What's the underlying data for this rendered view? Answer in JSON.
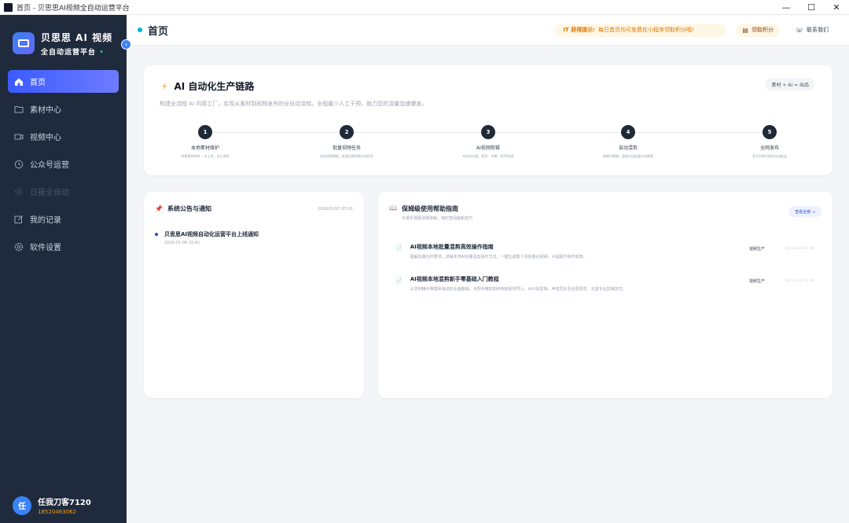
{
  "window": {
    "title": "首页 - 贝思思AI视频全自动运营平台",
    "minimize": "—",
    "maximize": "☐",
    "close": "✕"
  },
  "sidebar": {
    "brand_title": "贝思思 AI 视频",
    "brand_sub": "全自动运营平台",
    "brand_sub_dot": "•",
    "collapse_glyph": "‹",
    "items": [
      {
        "label": "首页",
        "icon": "home-icon"
      },
      {
        "label": "素材中心",
        "icon": "folder-icon"
      },
      {
        "label": "视频中心",
        "icon": "video-icon"
      },
      {
        "label": "公众号运营",
        "icon": "clock-icon"
      },
      {
        "label": "日报全自动",
        "icon": "settings-icon"
      },
      {
        "label": "我的记录",
        "icon": "edit-icon"
      },
      {
        "label": "软件设置",
        "icon": "gear-icon"
      }
    ],
    "user": {
      "avatar": "任",
      "name": "任我刀客7120",
      "phone": "18520463062"
    }
  },
  "header": {
    "title": "首页",
    "tip_label": "IT 获得提示:",
    "tip_text": "每日首页均可免费在小程序领取积分哦!",
    "points_icon": "▤",
    "points_label": "领取积分",
    "contact_icon": "☏",
    "contact_label": "联系我们"
  },
  "chain": {
    "icon": "⚡",
    "title": "AI 自动化生产链路",
    "tag": "素材 + AI = 出品",
    "desc": "构建全流程 AI 内容工厂，实现从素材到视频发布的全自动流转。全程最少人工干预，助力您的流量加速爆发。",
    "steps": [
      {
        "num": "1",
        "title": "本地素材维护",
        "desc": "构建素材库房 一次上传，永久使用"
      },
      {
        "num": "2",
        "title": "批量视频任务",
        "desc": "选定视频模板，批量创建视频生成任务"
      },
      {
        "num": "3",
        "title": "AI视频剪辑",
        "desc": "AI自动文案、配音、字幕、BGM合成"
      },
      {
        "num": "4",
        "title": "自动混剪",
        "desc": "根据AI策略，智能自动批量生成视频"
      },
      {
        "num": "5",
        "title": "全网发布",
        "desc": "多平台账号矩阵自动推送"
      }
    ]
  },
  "notice": {
    "icon": "📌",
    "title": "系统公告与通知",
    "date_header": "2026/01/07 07:01",
    "items": [
      {
        "title": "贝思思AI视频自动化运营平台上线通知",
        "date": "2026-01-06 10:42"
      }
    ]
  },
  "guide": {
    "icon": "📖",
    "title": "保姆级使用帮助指南",
    "sub": "手把手视频详细讲解，随时查阅最新技巧",
    "view_all": "查看全部 →",
    "articles": [
      {
        "icon": "📄",
        "title": "AI视频本地批量混剪高效操作指南",
        "desc": "图解批量创作要求，讲解本地AI批量混剪操作方法，一键生成数十至批量化视频，大幅提升制作效率。",
        "category": "视频生产",
        "date": "2026-01-06 10:48"
      },
      {
        "icon": "📄",
        "title": "AI视频本地混剪新手零基础入门教程",
        "desc": "从零到精手等循序渐进的全面教程，手把手教你如何使用素材导入、AI片段剪辑、声音同步及全局预览，无需专业剪辑技巧。",
        "category": "视频生产",
        "date": "2026-01-06 10:38"
      }
    ]
  }
}
